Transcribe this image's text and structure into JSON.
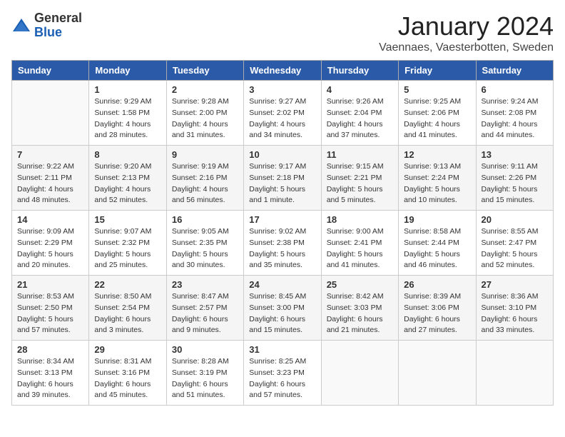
{
  "logo": {
    "general": "General",
    "blue": "Blue"
  },
  "title": "January 2024",
  "subtitle": "Vaennaes, Vaesterbotten, Sweden",
  "days_header": [
    "Sunday",
    "Monday",
    "Tuesday",
    "Wednesday",
    "Thursday",
    "Friday",
    "Saturday"
  ],
  "weeks": [
    [
      {
        "day": "",
        "info": ""
      },
      {
        "day": "1",
        "info": "Sunrise: 9:29 AM\nSunset: 1:58 PM\nDaylight: 4 hours\nand 28 minutes."
      },
      {
        "day": "2",
        "info": "Sunrise: 9:28 AM\nSunset: 2:00 PM\nDaylight: 4 hours\nand 31 minutes."
      },
      {
        "day": "3",
        "info": "Sunrise: 9:27 AM\nSunset: 2:02 PM\nDaylight: 4 hours\nand 34 minutes."
      },
      {
        "day": "4",
        "info": "Sunrise: 9:26 AM\nSunset: 2:04 PM\nDaylight: 4 hours\nand 37 minutes."
      },
      {
        "day": "5",
        "info": "Sunrise: 9:25 AM\nSunset: 2:06 PM\nDaylight: 4 hours\nand 41 minutes."
      },
      {
        "day": "6",
        "info": "Sunrise: 9:24 AM\nSunset: 2:08 PM\nDaylight: 4 hours\nand 44 minutes."
      }
    ],
    [
      {
        "day": "7",
        "info": "Sunrise: 9:22 AM\nSunset: 2:11 PM\nDaylight: 4 hours\nand 48 minutes."
      },
      {
        "day": "8",
        "info": "Sunrise: 9:20 AM\nSunset: 2:13 PM\nDaylight: 4 hours\nand 52 minutes."
      },
      {
        "day": "9",
        "info": "Sunrise: 9:19 AM\nSunset: 2:16 PM\nDaylight: 4 hours\nand 56 minutes."
      },
      {
        "day": "10",
        "info": "Sunrise: 9:17 AM\nSunset: 2:18 PM\nDaylight: 5 hours\nand 1 minute."
      },
      {
        "day": "11",
        "info": "Sunrise: 9:15 AM\nSunset: 2:21 PM\nDaylight: 5 hours\nand 5 minutes."
      },
      {
        "day": "12",
        "info": "Sunrise: 9:13 AM\nSunset: 2:24 PM\nDaylight: 5 hours\nand 10 minutes."
      },
      {
        "day": "13",
        "info": "Sunrise: 9:11 AM\nSunset: 2:26 PM\nDaylight: 5 hours\nand 15 minutes."
      }
    ],
    [
      {
        "day": "14",
        "info": "Sunrise: 9:09 AM\nSunset: 2:29 PM\nDaylight: 5 hours\nand 20 minutes."
      },
      {
        "day": "15",
        "info": "Sunrise: 9:07 AM\nSunset: 2:32 PM\nDaylight: 5 hours\nand 25 minutes."
      },
      {
        "day": "16",
        "info": "Sunrise: 9:05 AM\nSunset: 2:35 PM\nDaylight: 5 hours\nand 30 minutes."
      },
      {
        "day": "17",
        "info": "Sunrise: 9:02 AM\nSunset: 2:38 PM\nDaylight: 5 hours\nand 35 minutes."
      },
      {
        "day": "18",
        "info": "Sunrise: 9:00 AM\nSunset: 2:41 PM\nDaylight: 5 hours\nand 41 minutes."
      },
      {
        "day": "19",
        "info": "Sunrise: 8:58 AM\nSunset: 2:44 PM\nDaylight: 5 hours\nand 46 minutes."
      },
      {
        "day": "20",
        "info": "Sunrise: 8:55 AM\nSunset: 2:47 PM\nDaylight: 5 hours\nand 52 minutes."
      }
    ],
    [
      {
        "day": "21",
        "info": "Sunrise: 8:53 AM\nSunset: 2:50 PM\nDaylight: 5 hours\nand 57 minutes."
      },
      {
        "day": "22",
        "info": "Sunrise: 8:50 AM\nSunset: 2:54 PM\nDaylight: 6 hours\nand 3 minutes."
      },
      {
        "day": "23",
        "info": "Sunrise: 8:47 AM\nSunset: 2:57 PM\nDaylight: 6 hours\nand 9 minutes."
      },
      {
        "day": "24",
        "info": "Sunrise: 8:45 AM\nSunset: 3:00 PM\nDaylight: 6 hours\nand 15 minutes."
      },
      {
        "day": "25",
        "info": "Sunrise: 8:42 AM\nSunset: 3:03 PM\nDaylight: 6 hours\nand 21 minutes."
      },
      {
        "day": "26",
        "info": "Sunrise: 8:39 AM\nSunset: 3:06 PM\nDaylight: 6 hours\nand 27 minutes."
      },
      {
        "day": "27",
        "info": "Sunrise: 8:36 AM\nSunset: 3:10 PM\nDaylight: 6 hours\nand 33 minutes."
      }
    ],
    [
      {
        "day": "28",
        "info": "Sunrise: 8:34 AM\nSunset: 3:13 PM\nDaylight: 6 hours\nand 39 minutes."
      },
      {
        "day": "29",
        "info": "Sunrise: 8:31 AM\nSunset: 3:16 PM\nDaylight: 6 hours\nand 45 minutes."
      },
      {
        "day": "30",
        "info": "Sunrise: 8:28 AM\nSunset: 3:19 PM\nDaylight: 6 hours\nand 51 minutes."
      },
      {
        "day": "31",
        "info": "Sunrise: 8:25 AM\nSunset: 3:23 PM\nDaylight: 6 hours\nand 57 minutes."
      },
      {
        "day": "",
        "info": ""
      },
      {
        "day": "",
        "info": ""
      },
      {
        "day": "",
        "info": ""
      }
    ]
  ]
}
